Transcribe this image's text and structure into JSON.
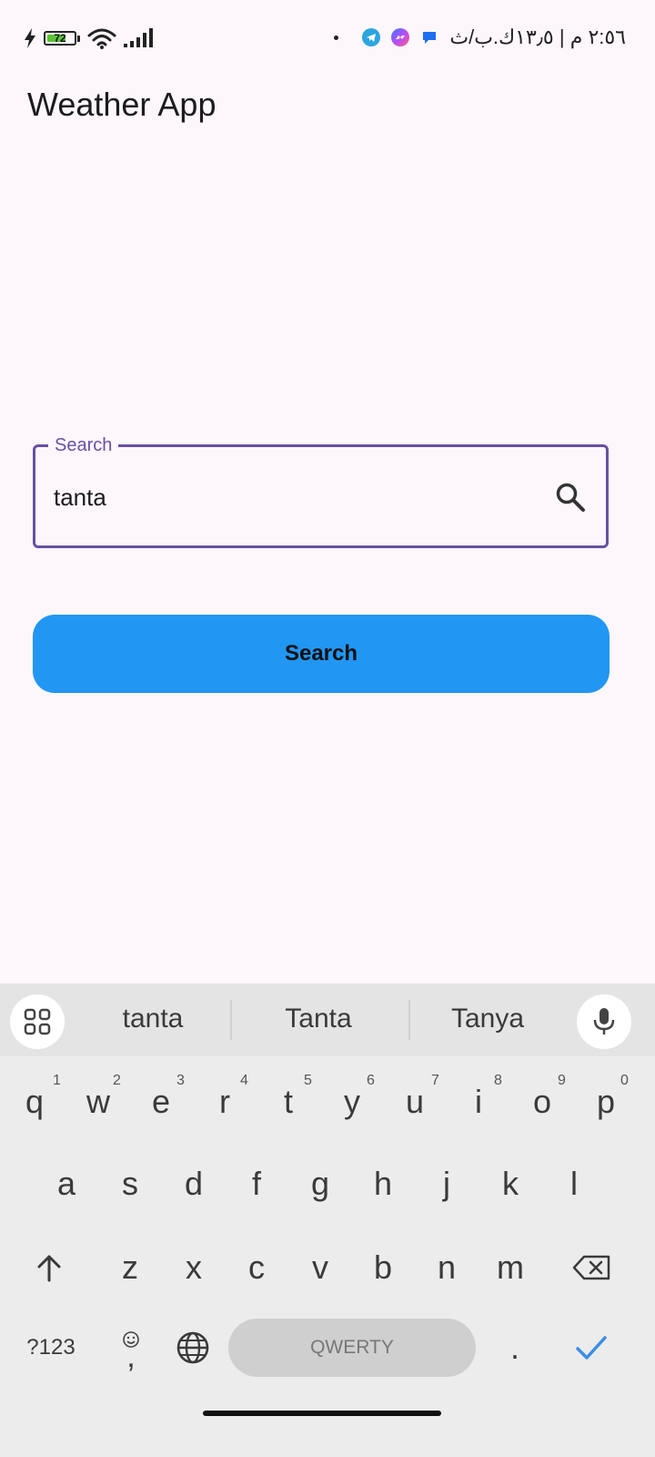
{
  "status_bar": {
    "battery_level": "72",
    "battery_fraction": 0.72,
    "clock": "٢:٥٦ م | ١٣٫٥ك.ب/ث",
    "icons": [
      "charging-bolt-icon",
      "battery-icon",
      "wifi-icon",
      "signal-icon",
      "dot-icon",
      "telegram-icon",
      "messenger-icon",
      "chat-bubble-icon"
    ]
  },
  "app": {
    "title": "Weather App"
  },
  "search": {
    "label": "Search",
    "value": "tanta",
    "icon": "search-icon",
    "accent_color": "#6750a4"
  },
  "search_button": {
    "label": "Search",
    "color": "#2196f3"
  },
  "keyboard": {
    "suggestions": [
      "tanta",
      "Tanta",
      "Tanya"
    ],
    "row1": [
      "q",
      "w",
      "e",
      "r",
      "t",
      "y",
      "u",
      "i",
      "o",
      "p"
    ],
    "row1_hints": [
      "1",
      "2",
      "3",
      "4",
      "5",
      "6",
      "7",
      "8",
      "9",
      "0"
    ],
    "row2": [
      "a",
      "s",
      "d",
      "f",
      "g",
      "h",
      "j",
      "k",
      "l"
    ],
    "row3": [
      "z",
      "x",
      "c",
      "v",
      "b",
      "n",
      "m"
    ],
    "symbols_label": "?123",
    "comma": ",",
    "period": ".",
    "space_label": "QWERTY",
    "enter_color": "#3a8ee6"
  }
}
